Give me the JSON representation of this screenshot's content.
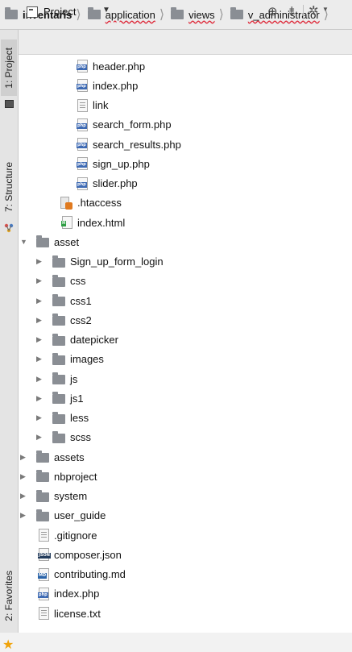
{
  "breadcrumb": [
    {
      "label": "inventaris",
      "style": "bold"
    },
    {
      "label": "application",
      "style": "wavy"
    },
    {
      "label": "views",
      "style": "wavy"
    },
    {
      "label": "v_administrator",
      "style": "wavy"
    }
  ],
  "tool_strip": {
    "project_tab": "1: Project",
    "structure_tab": "7: Structure",
    "favorites_tab": "2: Favorites"
  },
  "panel": {
    "title": "Project",
    "icons": [
      "project-view-icon",
      "chevron-down-icon",
      "target-icon",
      "collapse-all-icon",
      "gear-icon"
    ]
  },
  "tree": [
    {
      "name": "header.php",
      "kind": "php",
      "depth": 3,
      "expanded": null
    },
    {
      "name": "index.php",
      "kind": "php",
      "depth": 3,
      "expanded": null
    },
    {
      "name": "link",
      "kind": "link",
      "depth": 3,
      "expanded": null
    },
    {
      "name": "search_form.php",
      "kind": "php",
      "depth": 3,
      "expanded": null
    },
    {
      "name": "search_results.php",
      "kind": "php",
      "depth": 3,
      "expanded": null
    },
    {
      "name": "sign_up.php",
      "kind": "php",
      "depth": 3,
      "expanded": null
    },
    {
      "name": "slider.php",
      "kind": "php",
      "depth": 3,
      "expanded": null
    },
    {
      "name": ".htaccess",
      "kind": "htaccess",
      "depth": 2,
      "expanded": null
    },
    {
      "name": "index.html",
      "kind": "html",
      "depth": 2,
      "expanded": null
    },
    {
      "name": "asset",
      "kind": "folder",
      "depth": 0,
      "expanded": true
    },
    {
      "name": "Sign_up_form_login",
      "kind": "folder",
      "depth": 1,
      "expanded": false
    },
    {
      "name": "css",
      "kind": "folder",
      "depth": 1,
      "expanded": false
    },
    {
      "name": "css1",
      "kind": "folder",
      "depth": 1,
      "expanded": false
    },
    {
      "name": "css2",
      "kind": "folder",
      "depth": 1,
      "expanded": false
    },
    {
      "name": "datepicker",
      "kind": "folder",
      "depth": 1,
      "expanded": false
    },
    {
      "name": "images",
      "kind": "folder",
      "depth": 1,
      "expanded": false
    },
    {
      "name": "js",
      "kind": "folder",
      "depth": 1,
      "expanded": false
    },
    {
      "name": "js1",
      "kind": "folder",
      "depth": 1,
      "expanded": false
    },
    {
      "name": "less",
      "kind": "folder",
      "depth": 1,
      "expanded": false
    },
    {
      "name": "scss",
      "kind": "folder",
      "depth": 1,
      "expanded": false
    },
    {
      "name": "assets",
      "kind": "folder",
      "depth": 0,
      "expanded": false
    },
    {
      "name": "nbproject",
      "kind": "folder",
      "depth": 0,
      "expanded": false
    },
    {
      "name": "system",
      "kind": "folder",
      "depth": 0,
      "expanded": false
    },
    {
      "name": "user_guide",
      "kind": "folder",
      "depth": 0,
      "expanded": false
    },
    {
      "name": ".gitignore",
      "kind": "text",
      "depth": 0,
      "expanded": null
    },
    {
      "name": "composer.json",
      "kind": "json",
      "depth": 0,
      "expanded": null
    },
    {
      "name": "contributing.md",
      "kind": "md",
      "depth": 0,
      "expanded": null
    },
    {
      "name": "index.php",
      "kind": "php",
      "depth": 0,
      "expanded": null
    },
    {
      "name": "license.txt",
      "kind": "text",
      "depth": 0,
      "expanded": null
    }
  ],
  "file_tags": {
    "php": "php",
    "json": "JSON",
    "md": "MD",
    "html": "H"
  },
  "colors": {
    "folder": "#8a8e94",
    "php_tag": "#3e6ab3",
    "favorites_star": "#f0a30a",
    "htaccess": "#e07a1f"
  }
}
